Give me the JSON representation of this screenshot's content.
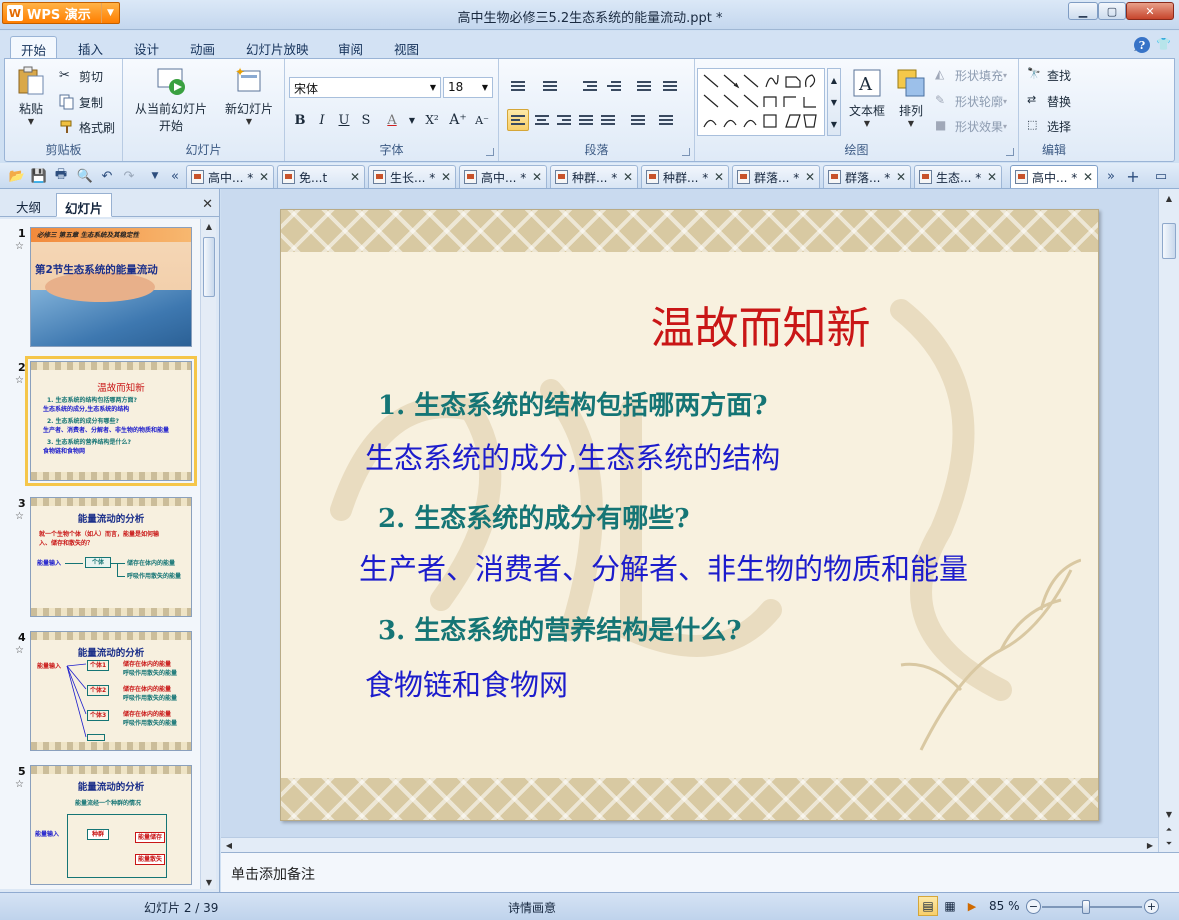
{
  "app": {
    "menu_label": "WPS 演示",
    "logo_letter": "W"
  },
  "window": {
    "title": "高中生物必修三5.2生态系统的能量流动.ppt *"
  },
  "ribbon_tabs": [
    "开始",
    "插入",
    "设计",
    "动画",
    "幻灯片放映",
    "审阅",
    "视图"
  ],
  "ribbon": {
    "clipboard": {
      "paste": "粘贴",
      "cut": "剪切",
      "copy": "复制",
      "format_painter": "格式刷",
      "group": "剪贴板"
    },
    "slides": {
      "from_current_line1": "从当前幻灯片",
      "from_current_line2": "开始",
      "new_slide": "新幻灯片",
      "group": "幻灯片"
    },
    "font": {
      "font_name": "宋体",
      "font_size": "18",
      "group": "字体"
    },
    "paragraph": {
      "group": "段落"
    },
    "drawing": {
      "textbox": "文本框",
      "arrange": "排列",
      "shape_fill": "形状填充",
      "shape_outline": "形状轮廓",
      "shape_effects": "形状效果",
      "group": "绘图"
    },
    "edit": {
      "find": "查找",
      "replace": "替换",
      "select": "选择",
      "group": "编辑"
    }
  },
  "doc_tabs": [
    "高中... *",
    "免...t",
    "生长... *",
    "高中... *",
    "种群... *",
    "种群... *",
    "群落... *",
    "群落... *",
    "生态... *",
    "高中... *"
  ],
  "panel": {
    "outline_tab": "大纲",
    "slides_tab": "幻灯片"
  },
  "thumbnails": {
    "s1": {
      "num": "1",
      "header": "必修三  第五章  生态系统及其稳定性",
      "title": "第2节生态系统的能量流动"
    },
    "s2": {
      "num": "2",
      "title": "温故而知新",
      "lines": [
        "1. 生态系统的结构包括哪两方面?",
        "生态系统的成分,生态系统的结构",
        "2. 生态系统的成分有哪些?",
        "生产者、消费者、分解者、非生物的物质和能量",
        "3. 生态系统的营养结构是什么?",
        "食物链和食物网"
      ]
    },
    "s3": {
      "num": "3",
      "title": "能量流动的分析",
      "lines": [
        "就一个生物个体（如人）而言，能量是如何输",
        "入、储存和散失的？",
        "能量输入",
        "个体",
        "储存在体内的能量",
        "呼吸作用散失的能量"
      ]
    },
    "s4": {
      "num": "4",
      "title": "能量流动的分析",
      "lines": [
        "能量输入",
        "个体1",
        "储存在体内的能量",
        "呼吸作用散失的能量",
        "个体2",
        "储存在体内的能量",
        "呼吸作用散失的能量",
        "个体3",
        "储存在体内的能量",
        "呼吸作用散失的能量"
      ]
    },
    "s5": {
      "num": "5",
      "title": "能量流动的分析",
      "lines": [
        "能量流经一个种群的情况",
        "能量输入",
        "种群",
        "能量储存",
        "能量散失"
      ]
    }
  },
  "slide": {
    "title": "温故而知新",
    "q1": "1. 生态系统的结构包括哪两方面?",
    "a1": "生态系统的成分,生态系统的结构",
    "q2": "2. 生态系统的成分有哪些?",
    "a2": "生产者、消费者、分解者、非生物的物质和能量",
    "q3": "3. 生态系统的营养结构是什么?",
    "a3": "食物链和食物网"
  },
  "notes_placeholder": "单击添加备注",
  "status": {
    "slide_count": "幻灯片 2 / 39",
    "theme": "诗情画意",
    "zoom": "85 %"
  },
  "colors": {
    "title_red": "#c91616",
    "question_teal": "#157575",
    "answer_blue": "#1c1ccc",
    "accent_orange": "#ff7e00"
  }
}
